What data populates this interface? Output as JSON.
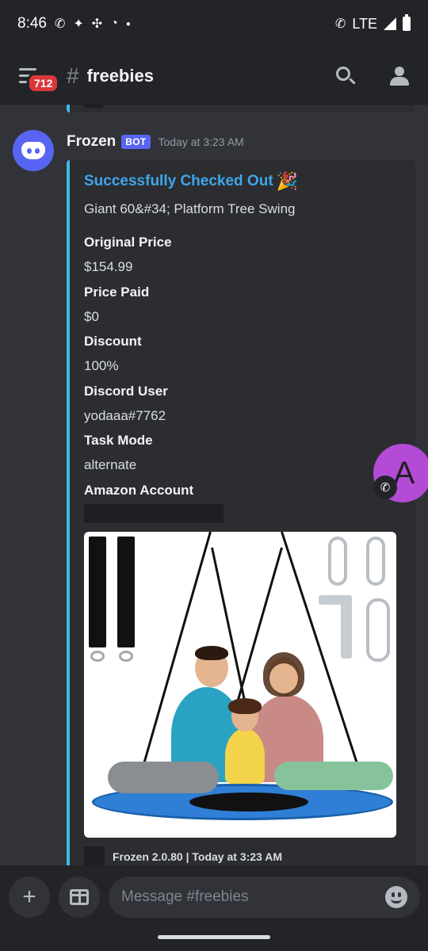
{
  "status_bar": {
    "time": "8:46",
    "network": "LTE",
    "icons_left": [
      "call-icon",
      "twitter-icon",
      "pinwheel-icon",
      "app-icon",
      "dot-icon"
    ],
    "icons_right": [
      "wifi-call-icon",
      "signal-icon",
      "battery-icon"
    ]
  },
  "header": {
    "notification_count": "712",
    "channel_hash": "#",
    "channel_name": "freebies"
  },
  "message": {
    "author": "Frozen",
    "bot_tag": "BOT",
    "timestamp": "Today at 3:23 AM",
    "embed": {
      "accent_color": "#3fb8e8",
      "title": "Successfully Checked Out",
      "title_emoji": "🎉",
      "description": "Giant 60&#34; Platform Tree Swing",
      "fields": [
        {
          "name": "Original Price",
          "value": "$154.99"
        },
        {
          "name": "Price Paid",
          "value": "$0"
        },
        {
          "name": "Discount",
          "value": "100%"
        },
        {
          "name": "Discord User",
          "value": "yodaaa#7762"
        },
        {
          "name": "Task Mode",
          "value": "alternate"
        },
        {
          "name": "Amazon Account",
          "value": ""
        }
      ],
      "footer": "Frozen 2.0.80 | Today at 3:23 AM"
    }
  },
  "call_bubble": {
    "letter": "A"
  },
  "composer": {
    "placeholder": "Message #freebies",
    "add_label": "+"
  }
}
